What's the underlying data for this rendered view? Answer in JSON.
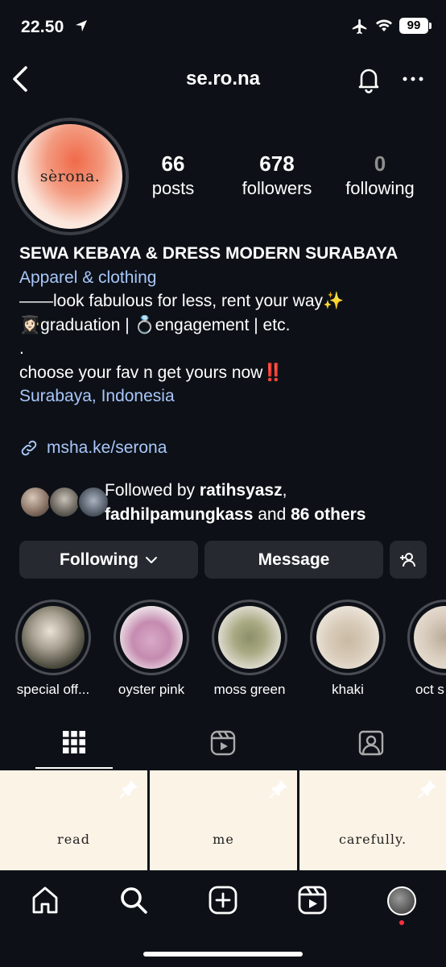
{
  "status_bar": {
    "time": "22.50",
    "battery": "99"
  },
  "header": {
    "username": "se.ro.na"
  },
  "profile": {
    "avatar_text": "sèrona.",
    "stats": [
      {
        "value": "66",
        "label": "posts"
      },
      {
        "value": "678",
        "label": "followers"
      },
      {
        "value": "0",
        "label": "following"
      }
    ],
    "name": "SEWA KEBAYA & DRESS MODERN SURABAYA",
    "category": "Apparel & clothing",
    "bio_lines": [
      "——look fabulous for less, rent your way✨",
      "👩🏻‍🎓graduation | 💍engagement | etc.",
      ".",
      "choose your fav n get yours now‼️"
    ],
    "location": "Surabaya, Indonesia",
    "link": "msha.ke/serona",
    "followed_by": {
      "prefix": "Followed by ",
      "user1": "ratihsyasz",
      "sep": ",",
      "user2": "fadhilpamungkass",
      "and": " and ",
      "others": "86 others"
    }
  },
  "actions": {
    "following": "Following",
    "message": "Message"
  },
  "highlights": [
    {
      "label": "special off..."
    },
    {
      "label": "oyster pink"
    },
    {
      "label": "moss green"
    },
    {
      "label": "khaki"
    },
    {
      "label": "oct s"
    }
  ],
  "tabs": [
    "grid-icon",
    "reels-icon",
    "tagged-icon"
  ],
  "posts": [
    {
      "caption": "read"
    },
    {
      "caption": "me"
    },
    {
      "caption": "carefully."
    }
  ],
  "nav": [
    "home-icon",
    "search-icon",
    "create-icon",
    "reels-icon",
    "profile-avatar"
  ]
}
